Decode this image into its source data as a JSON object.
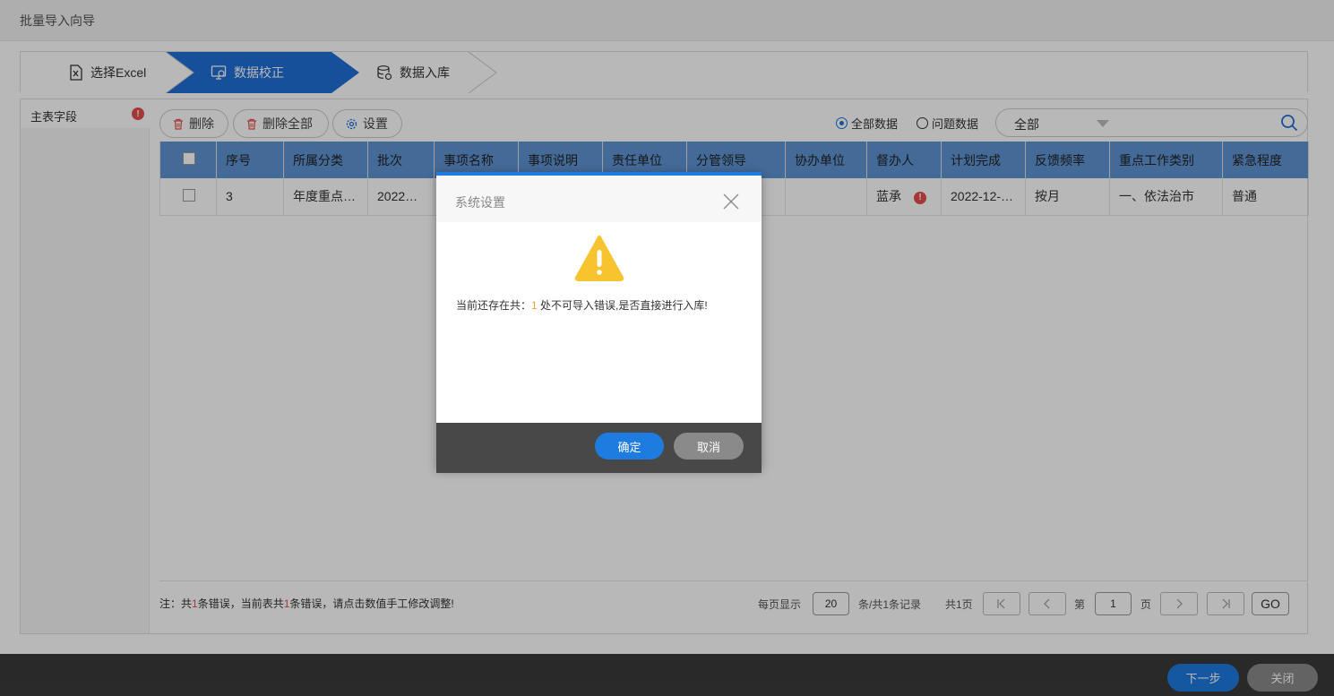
{
  "window": {
    "title": "批量导入向导"
  },
  "steps": [
    {
      "label": "选择Excel",
      "icon": "excel-file-icon",
      "state": "done"
    },
    {
      "label": "数据校正",
      "icon": "data-check-icon",
      "state": "active"
    },
    {
      "label": "数据入库",
      "icon": "database-icon",
      "state": "pending"
    }
  ],
  "left_panel": {
    "items": [
      {
        "label": "主表字段",
        "error_mark": "!"
      }
    ]
  },
  "toolbar": {
    "delete_label": "删除",
    "delete_all_label": "删除全部",
    "settings_label": "设置"
  },
  "filter": {
    "all_data_label": "全部数据",
    "problem_data_label": "问题数据",
    "selected": "all"
  },
  "search": {
    "dropdown_value": "全部"
  },
  "table": {
    "columns": [
      "序号",
      "所属分类",
      "批次",
      "事项名称",
      "事项说明",
      "责任单位",
      "分管领导",
      "协办单位",
      "督办人",
      "计划完成",
      "反馈频率",
      "重点工作类别",
      "紧急程度"
    ],
    "rows": [
      {
        "cells": [
          "3",
          "年度重点…",
          "2022…",
          "",
          "",
          "",
          "",
          "",
          "蓝承",
          "2022-12-…",
          "按月",
          "一、依法治市",
          "普通"
        ],
        "error_mark": "!"
      }
    ]
  },
  "note": {
    "prefix": "注：共",
    "count1": "1",
    "mid": "条错误，当前表共",
    "count2": "1",
    "suffix": "条错误，请点击数值手工修改调整!"
  },
  "pager": {
    "per_page_label": "每页显示",
    "per_page_value": "20",
    "records_label": "条/共1条记录",
    "total_pages_label": "共1页",
    "page_prefix": "第",
    "page_value": "1",
    "page_suffix": "页",
    "go_label": "GO"
  },
  "footer": {
    "next_label": "下一步",
    "close_label": "关闭"
  },
  "dialog": {
    "title": "系统设置",
    "message_prefix": "当前还存在共：",
    "message_count": "1",
    "message_suffix": " 处不可导入错误,是否直接进行入库!",
    "confirm_label": "确定",
    "cancel_label": "取消"
  },
  "colors": {
    "accent": "#1e7be0",
    "step_active": "#1f6fd6",
    "header_bg": "#5f93d3",
    "error": "#e54d4d",
    "warning": "#f7c430"
  }
}
